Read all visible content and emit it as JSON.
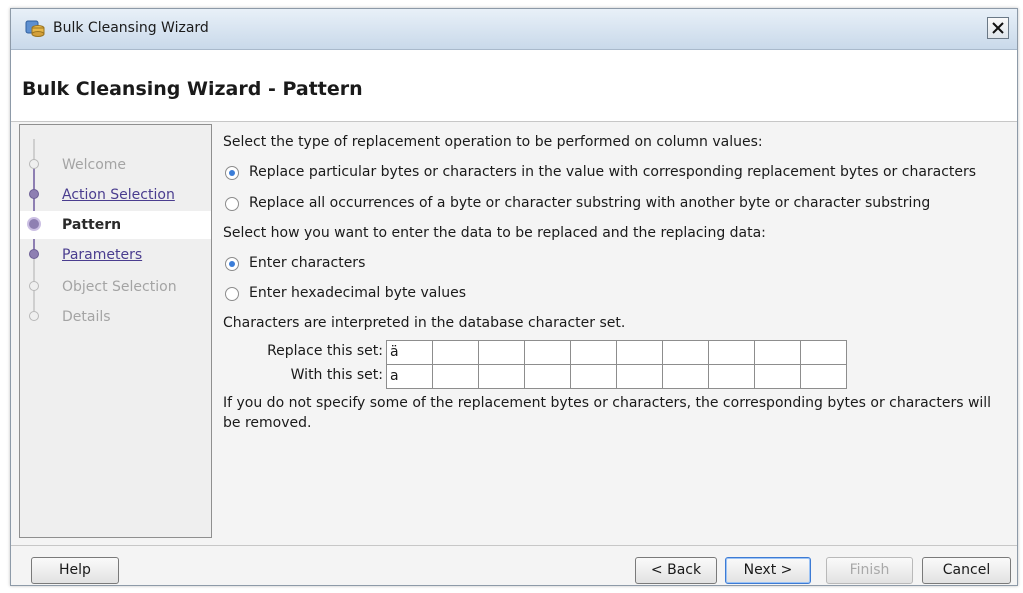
{
  "window": {
    "title": "Bulk Cleansing Wizard"
  },
  "header": {
    "title": "Bulk Cleansing Wizard - Pattern"
  },
  "steps": [
    {
      "label": "Welcome",
      "state": "disabled"
    },
    {
      "label": "Action Selection",
      "state": "done"
    },
    {
      "label": "Pattern",
      "state": "current"
    },
    {
      "label": "Parameters",
      "state": "done"
    },
    {
      "label": "Object Selection",
      "state": "disabled"
    },
    {
      "label": "Details",
      "state": "disabled"
    }
  ],
  "content": {
    "operation_prompt": "Select the type of replacement operation to be performed on column values:",
    "op_options": [
      {
        "label": "Replace particular bytes or characters in the value with corresponding replacement bytes or characters",
        "selected": true
      },
      {
        "label": "Replace all occurrences of a byte or character substring with another byte or character substring",
        "selected": false
      }
    ],
    "entry_prompt": "Select how you want to enter the data to be replaced and the replacing data:",
    "entry_options": [
      {
        "label": "Enter characters",
        "selected": true
      },
      {
        "label": "Enter hexadecimal byte values",
        "selected": false
      }
    ],
    "charset_note": "Characters are interpreted in the database character set.",
    "replace_label": "Replace this set:",
    "with_label": "With this set:",
    "replace_values": [
      "ä",
      "",
      "",
      "",
      "",
      "",
      "",
      "",
      "",
      ""
    ],
    "with_values": [
      "a",
      "",
      "",
      "",
      "",
      "",
      "",
      "",
      "",
      ""
    ],
    "footnote": "If you do not specify some of the replacement bytes or characters, the corresponding bytes or characters will be removed."
  },
  "buttons": {
    "help": "Help",
    "back": "< Back",
    "next": "Next >",
    "finish": "Finish",
    "cancel": "Cancel"
  },
  "colors": {
    "accent_purple": "#8e7fb2",
    "link": "#4a3d8f",
    "radio_selected": "#3b7dd8",
    "default_button_border": "#3d7bd4"
  }
}
